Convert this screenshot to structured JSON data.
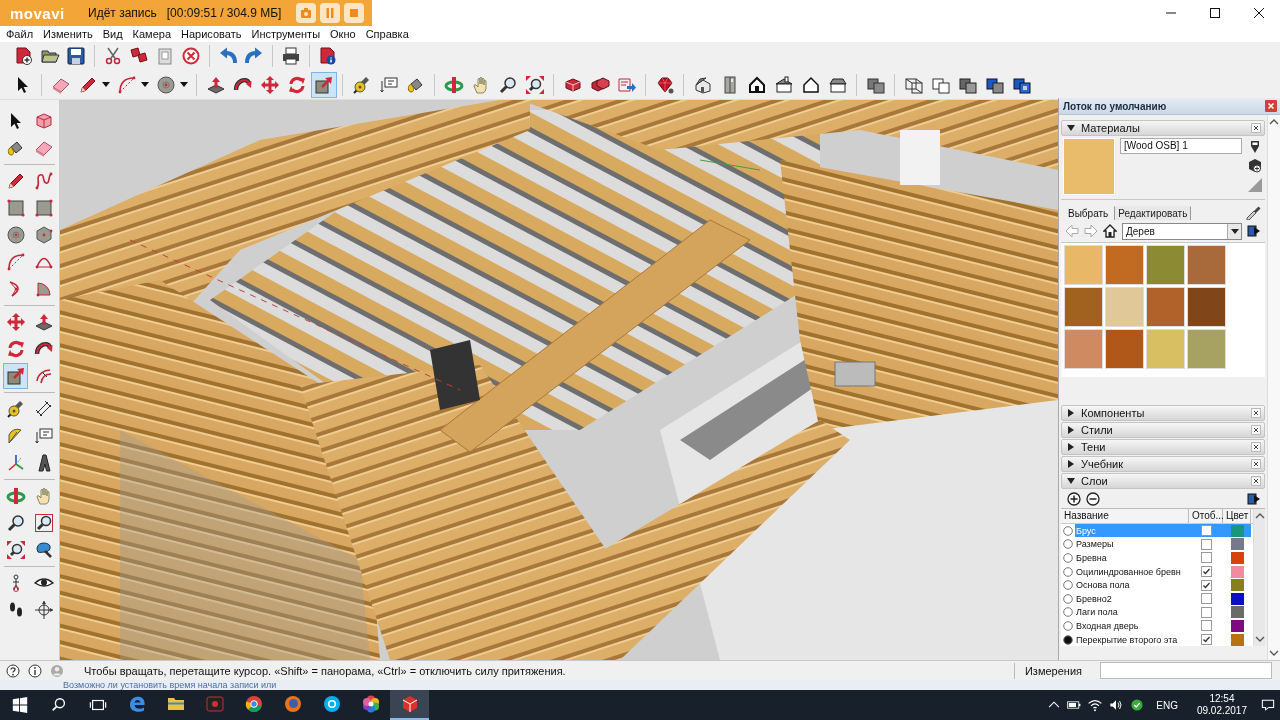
{
  "recorder": {
    "logo": "movavi",
    "status": "Идёт запись",
    "progress": "[00:09:51 / 304.9 МБ]"
  },
  "menu": [
    "Файл",
    "Изменить",
    "Вид",
    "Камера",
    "Нарисовать",
    "Инструменты",
    "Окно",
    "Справка"
  ],
  "drawing_toolbar": [
    {
      "selected": false
    },
    {
      "selected": false
    },
    {
      "selected": false
    },
    {
      "selected": false
    },
    {
      "selected": false
    },
    {
      "selected": false
    },
    {
      "selected": false
    },
    {
      "selected": false
    },
    {
      "selected": false
    },
    {
      "selected": true
    },
    {
      "selected": false
    },
    {
      "selected": false
    },
    {
      "selected": false
    },
    {
      "selected": false
    },
    {
      "selected": false
    },
    {
      "selected": false
    },
    {
      "selected": false
    },
    {
      "selected": false
    },
    {
      "selected": false
    },
    {
      "selected": false
    },
    {
      "selected": false
    },
    {
      "selected": false
    },
    {
      "selected": false
    },
    {
      "selected": false
    },
    {
      "selected": false
    },
    {
      "selected": false
    },
    {
      "selected": false
    },
    {
      "selected": false
    },
    {
      "selected": false
    },
    {
      "selected": false
    },
    {
      "selected": false
    },
    {
      "selected": false
    },
    {
      "selected": false
    }
  ],
  "tool_palette": [
    {
      "selected": false
    },
    {
      "selected": false
    },
    {
      "selected": false
    },
    {
      "selected": false
    },
    {
      "selected": false
    },
    {
      "selected": false
    },
    {
      "selected": false
    },
    {
      "selected": false
    },
    {
      "selected": false
    },
    {
      "selected": false
    },
    {
      "selected": false
    },
    {
      "selected": false
    },
    {
      "selected": false
    },
    {
      "selected": false
    },
    {
      "selected": false
    },
    {
      "selected": false
    },
    {
      "selected": false
    },
    {
      "selected": false
    },
    {
      "selected": true
    },
    {
      "selected": false
    },
    {
      "selected": false
    },
    {
      "selected": false
    },
    {
      "selected": false
    },
    {
      "selected": false
    },
    {
      "selected": false
    },
    {
      "selected": false
    },
    {
      "selected": false
    },
    {
      "selected": false
    },
    {
      "selected": false
    },
    {
      "selected": false
    },
    {
      "selected": false
    },
    {
      "selected": false
    },
    {
      "selected": false
    },
    {
      "selected": false
    },
    {
      "selected": false
    },
    {
      "selected": false
    }
  ],
  "tray": {
    "title": "Лоток по умолчанию",
    "sections": [
      {
        "title": "Материалы",
        "expanded": true,
        "materials": {
          "material_name": "[Wood OSB] 1",
          "tabs": [
            {
              "label": "Выбрать",
              "selected": true
            },
            {
              "label": "Редактировать",
              "selected": false
            }
          ],
          "library": "Дерев",
          "swatches": [
            {
              "color": "#e8b868"
            },
            {
              "color": "#c06a22"
            },
            {
              "color": "#8c8a32"
            },
            {
              "color": "#a86a3a"
            },
            {
              "color": "#a0621e"
            },
            {
              "color": "#e0c898"
            },
            {
              "color": "#b0622a"
            },
            {
              "color": "#80461a"
            },
            {
              "color": "#d08a62"
            },
            {
              "color": "#b0581a"
            },
            {
              "color": "#d8c062"
            },
            {
              "color": "#a8a262"
            }
          ]
        }
      },
      {
        "title": "Компоненты",
        "expanded": false
      },
      {
        "title": "Стили",
        "expanded": false
      },
      {
        "title": "Тени",
        "expanded": false
      },
      {
        "title": "Учебник",
        "expanded": false
      },
      {
        "title": "Слои",
        "expanded": true,
        "layers": {
          "columns": [
            "Название",
            "Отоб...",
            "Цвет"
          ],
          "rows": [
            {
              "name": "Брус",
              "selected": true,
              "active": false,
              "visible": false,
              "color": "#17977b"
            },
            {
              "name": "Размеры",
              "selected": false,
              "active": false,
              "visible": false,
              "color": "#767a8e"
            },
            {
              "name": "Бревна",
              "selected": false,
              "active": false,
              "visible": false,
              "color": "#d5430f"
            },
            {
              "name": "Оцилиндрованное бревн",
              "selected": false,
              "active": false,
              "visible": true,
              "color": "#f28aa0"
            },
            {
              "name": "Основа пола",
              "selected": false,
              "active": false,
              "visible": true,
              "color": "#85801a"
            },
            {
              "name": "Бревно2",
              "selected": false,
              "active": false,
              "visible": false,
              "color": "#0a10c8"
            },
            {
              "name": "Лаги пола",
              "selected": false,
              "active": false,
              "visible": false,
              "color": "#6a6a6a"
            },
            {
              "name": "Входная дверь",
              "selected": false,
              "active": false,
              "visible": false,
              "color": "#7f0a80"
            },
            {
              "name": "Перекрытие второго эта",
              "selected": false,
              "active": true,
              "visible": true,
              "color": "#b8720f"
            }
          ]
        }
      }
    ]
  },
  "status_bar": {
    "hint": "Чтобы вращать, перетащите курсор. «Shift» = панорама, «Ctrl» = отключить силу притяжения.",
    "measurements_label": "Измерения"
  },
  "background_window": {
    "text": "Возможно ли установить время начала записи или"
  },
  "taskbar": {
    "apps": [
      {
        "selected": false
      },
      {
        "selected": false
      },
      {
        "selected": false
      },
      {
        "selected": false
      },
      {
        "selected": false
      },
      {
        "selected": false
      },
      {
        "selected": false
      },
      {
        "selected": true
      }
    ],
    "language": "ENG",
    "time": "12:54",
    "date": "09.02.2017"
  }
}
